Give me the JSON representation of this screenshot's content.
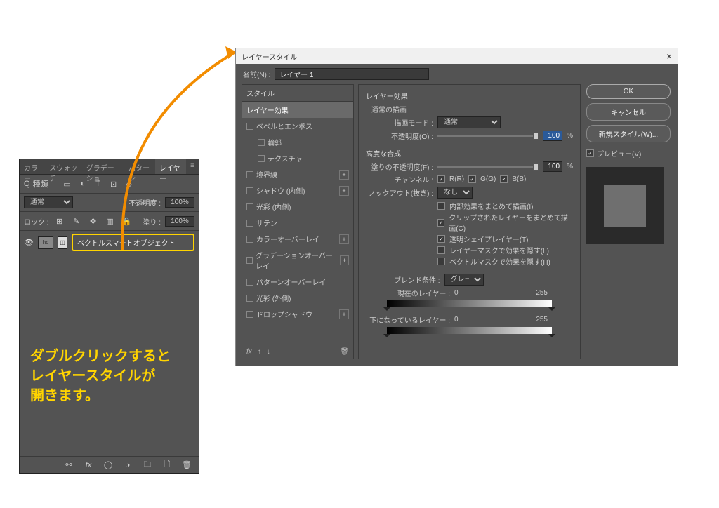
{
  "layers_panel": {
    "tabs": [
      "カラー",
      "スウォッチ",
      "グラデーショ",
      "パターン",
      "レイヤー"
    ],
    "active_tab_index": 4,
    "search_prefix": "Q",
    "search_label": "種類",
    "toolbar_icons": [
      "image-icon",
      "adjust-icon",
      "type-icon",
      "crop-icon",
      "shape-icon"
    ],
    "blend_mode": "通常",
    "opacity_label": "不透明度 :",
    "opacity_value": "100%",
    "lock_label": "ロック :",
    "fill_label": "塗り :",
    "fill_value": "100%",
    "layer_name": "ベクトルスマートオブジェクト",
    "bottom_icons": [
      "link-icon",
      "fx-icon",
      "mask-icon",
      "adjustment-icon",
      "folder-icon",
      "new-icon",
      "trash-icon"
    ]
  },
  "annotation": {
    "line1": "ダブルクリックすると",
    "line2": "レイヤースタイルが",
    "line3": "開きます。"
  },
  "dialog": {
    "title": "レイヤースタイル",
    "name_label": "名前(N) :",
    "name_value": "レイヤー 1",
    "styles_header": "スタイル",
    "style_items": [
      {
        "label": "レイヤー効果",
        "active": true
      },
      {
        "label": "ベベルとエンボス",
        "checkbox": true
      },
      {
        "label": "輪郭",
        "checkbox": true,
        "sub": true
      },
      {
        "label": "テクスチャ",
        "checkbox": true,
        "sub": true
      },
      {
        "label": "境界線",
        "checkbox": true,
        "plus": true
      },
      {
        "label": "シャドウ (内側)",
        "checkbox": true,
        "plus": true
      },
      {
        "label": "光彩 (内側)",
        "checkbox": true
      },
      {
        "label": "サテン",
        "checkbox": true
      },
      {
        "label": "カラーオーバーレイ",
        "checkbox": true,
        "plus": true
      },
      {
        "label": "グラデーションオーバーレイ",
        "checkbox": true,
        "plus": true
      },
      {
        "label": "パターンオーバーレイ",
        "checkbox": true
      },
      {
        "label": "光彩 (外側)",
        "checkbox": true
      },
      {
        "label": "ドロップシャドウ",
        "checkbox": true,
        "plus": true
      }
    ],
    "center": {
      "section1_title": "レイヤー効果",
      "section1_sub": "通常の描画",
      "blend_mode_label": "描画モード :",
      "blend_mode_value": "通常",
      "opacity_label": "不透明度(O) :",
      "opacity_value": "100",
      "percent": "%",
      "section2_title": "高度な合成",
      "fill_opacity_label": "塗りの不透明度(F) :",
      "fill_opacity_value": "100",
      "channel_label": "チャンネル :",
      "channel_r": "R(R)",
      "channel_g": "G(G)",
      "channel_b": "B(B)",
      "knockout_label": "ノックアウト(抜き) :",
      "knockout_value": "なし",
      "adv_checks": [
        {
          "label": "内部効果をまとめて描画(I)",
          "checked": false
        },
        {
          "label": "クリップされたレイヤーをまとめて描画(C)",
          "checked": true
        },
        {
          "label": "透明シェイプレイヤー(T)",
          "checked": true
        },
        {
          "label": "レイヤーマスクで効果を隠す(L)",
          "checked": false
        },
        {
          "label": "ベクトルマスクで効果を隠す(H)",
          "checked": false
        }
      ],
      "blendif_label": "ブレンド条件 :",
      "blendif_value": "グレー",
      "this_layer_label": "現在のレイヤー :",
      "this_layer_low": "0",
      "this_layer_high": "255",
      "under_layer_label": "下になっているレイヤー :",
      "under_layer_low": "0",
      "under_layer_high": "255"
    },
    "right": {
      "ok": "OK",
      "cancel": "キャンセル",
      "new_style": "新規スタイル(W)...",
      "preview": "プレビュー(V)"
    }
  }
}
